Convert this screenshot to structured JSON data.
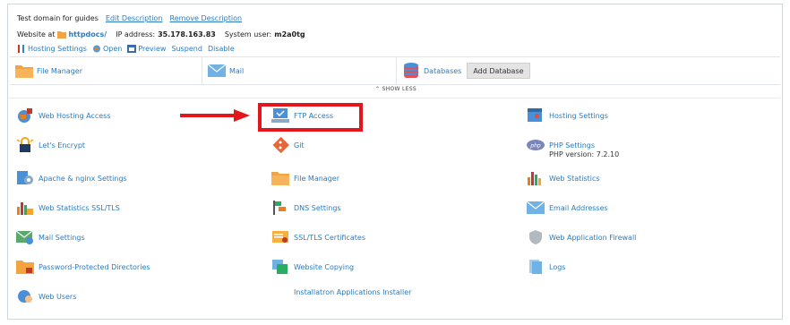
{
  "header": {
    "domain_desc": "Test domain for guides",
    "edit_description": "Edit Description",
    "remove_description": "Remove Description",
    "website_at_label": "Website at",
    "website_folder": "httpdocs/",
    "ip_label": "IP address:",
    "ip_value": "35.178.163.83",
    "user_label": "System user:",
    "user_value": "m2a0tg",
    "actions": {
      "hosting_settings": "Hosting Settings",
      "open": "Open",
      "preview": "Preview",
      "suspend": "Suspend",
      "disable": "Disable"
    }
  },
  "tiles": {
    "file_manager": "File Manager",
    "mail": "Mail",
    "databases": "Databases",
    "add_database": "Add Database"
  },
  "show_less": "SHOW LESS",
  "items": {
    "web_hosting_access": "Web Hosting Access",
    "ftp_access": "FTP Access",
    "hosting_settings": "Hosting Settings",
    "lets_encrypt": "Let's Encrypt",
    "git": "Git",
    "php_settings": "PHP Settings",
    "php_version": "PHP version: 7.2.10",
    "apache_nginx": "Apache & nginx Settings",
    "file_manager": "File Manager",
    "web_statistics": "Web Statistics",
    "web_stats_ssl": "Web Statistics SSL/TLS",
    "dns_settings": "DNS Settings",
    "email_addresses": "Email Addresses",
    "mail_settings": "Mail Settings",
    "ssl_certificates": "SSL/TLS Certificates",
    "waf": "Web Application Firewall",
    "password_dirs": "Password-Protected Directories",
    "website_copying": "Website Copying",
    "logs": "Logs",
    "web_users": "Web Users",
    "installatron": "Installatron Applications Installer"
  },
  "colors": {
    "link": "#2b7bc0",
    "highlight": "#e3161b"
  }
}
